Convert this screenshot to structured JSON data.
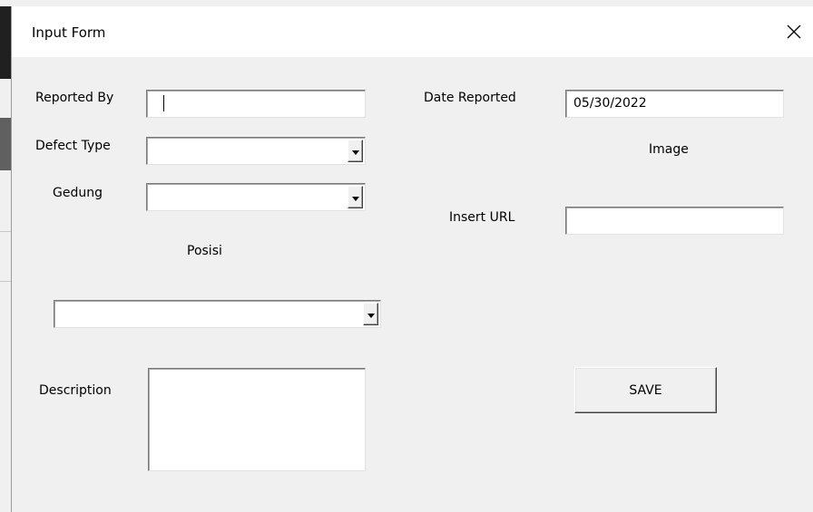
{
  "window": {
    "title": "Input Form",
    "close_icon": "close-icon"
  },
  "form": {
    "reported_by": {
      "label": "Reported By",
      "value": ""
    },
    "defect_type": {
      "label": "Defect Type",
      "value": ""
    },
    "gedung": {
      "label": "Gedung",
      "value": ""
    },
    "posisi": {
      "label": "Posisi",
      "value": ""
    },
    "description": {
      "label": "Description",
      "value": ""
    },
    "date_reported": {
      "label": "Date Reported",
      "value": "05/30/2022"
    },
    "image": {
      "label": "Image"
    },
    "insert_url": {
      "label": "Insert URL",
      "value": ""
    },
    "save_label": "SAVE"
  },
  "colors": {
    "dialog_bg": "#f0f0f0",
    "titlebar_bg": "#ffffff",
    "field_bg": "#ffffff"
  }
}
